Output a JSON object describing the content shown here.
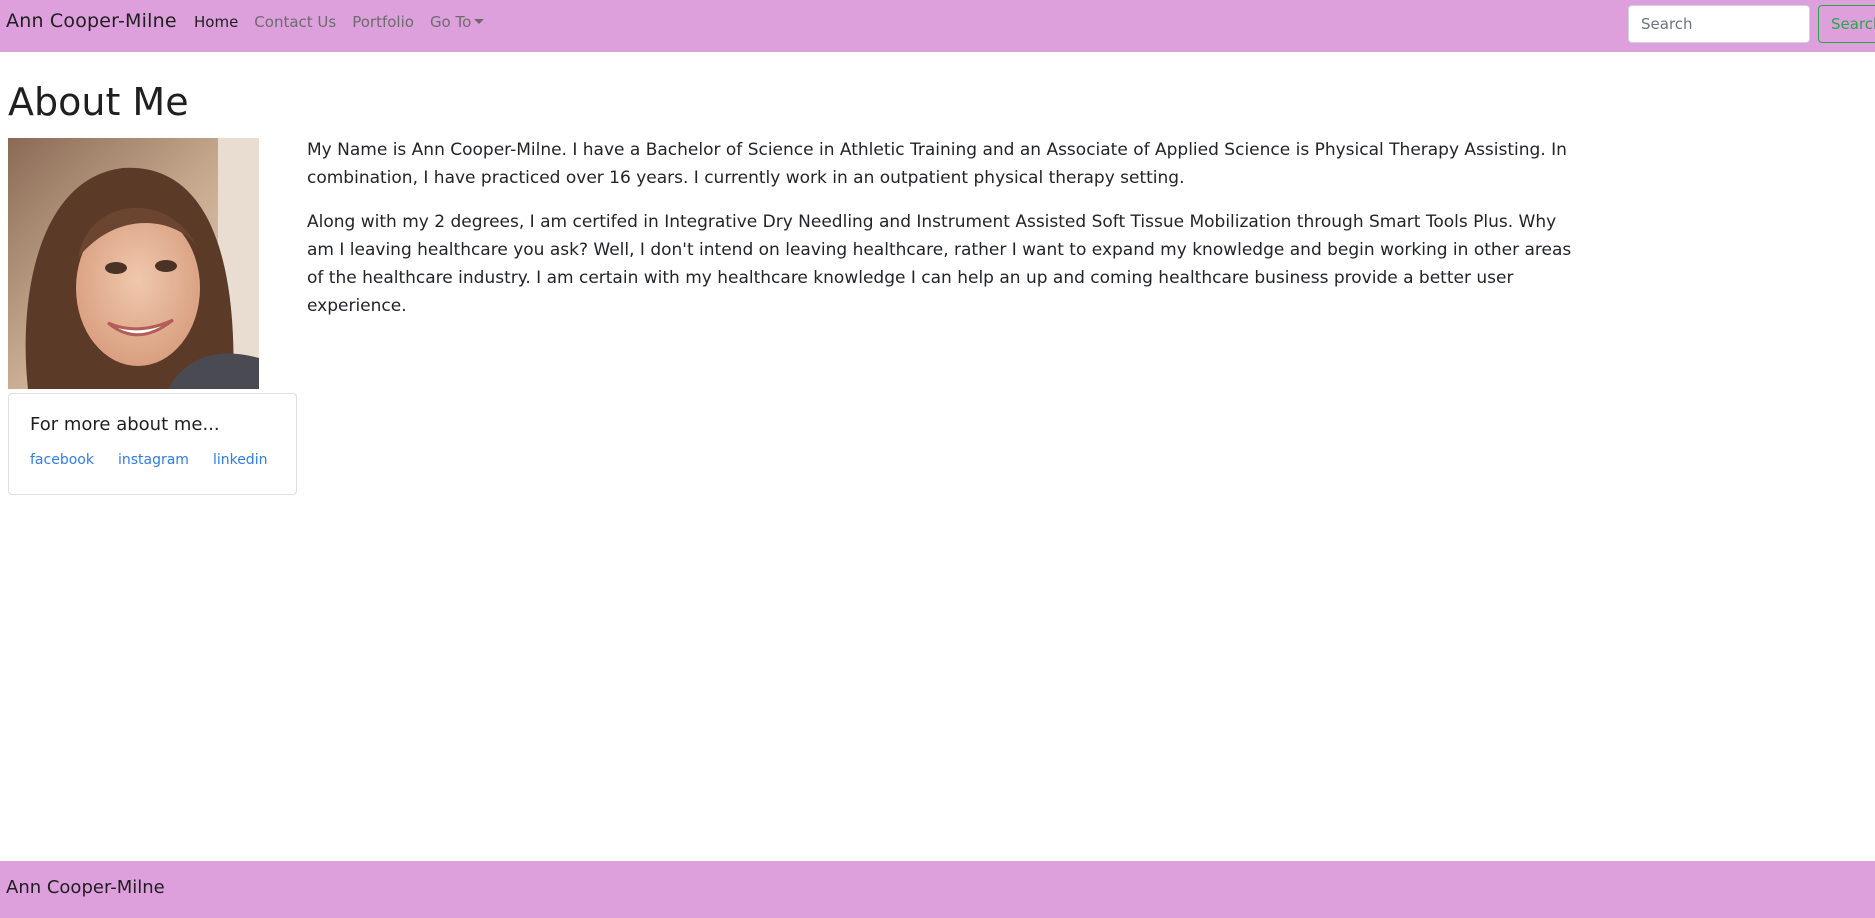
{
  "navbar": {
    "brand": "Ann Cooper-Milne",
    "links": [
      {
        "label": "Home"
      },
      {
        "label": "Contact Us"
      },
      {
        "label": "Portfolio"
      },
      {
        "label": "Go To"
      }
    ],
    "search_placeholder": "Search",
    "search_button": "Search",
    "background_color": "#dda0dd"
  },
  "main": {
    "title": "About Me",
    "bio_paragraphs": [
      "My Name is Ann Cooper-Milne. I have a Bachelor of Science in Athletic Training and an Associate of Applied Science is Physical Therapy Assisting. In combination, I have practiced over 16 years. I currently work in an outpatient physical therapy setting.",
      "Along with my 2 degrees, I am certifed in Integrative Dry Needling and Instrument Assisted Soft Tissue Mobilization through Smart Tools Plus. Why am I leaving healthcare you ask? Well, I don't intend on leaving healthcare, rather I want to expand my knowledge and begin working in other areas of the healthcare industry. I am certain with my healthcare knowledge I can help an up and coming healthcare business provide a better user experience."
    ],
    "social_card": {
      "title": "For more about me...",
      "links": [
        {
          "label": "facebook"
        },
        {
          "label": "instagram"
        },
        {
          "label": "linkedin"
        }
      ],
      "link_color": "#2f7de6"
    }
  },
  "footer": {
    "text": "Ann Cooper-Milne"
  }
}
